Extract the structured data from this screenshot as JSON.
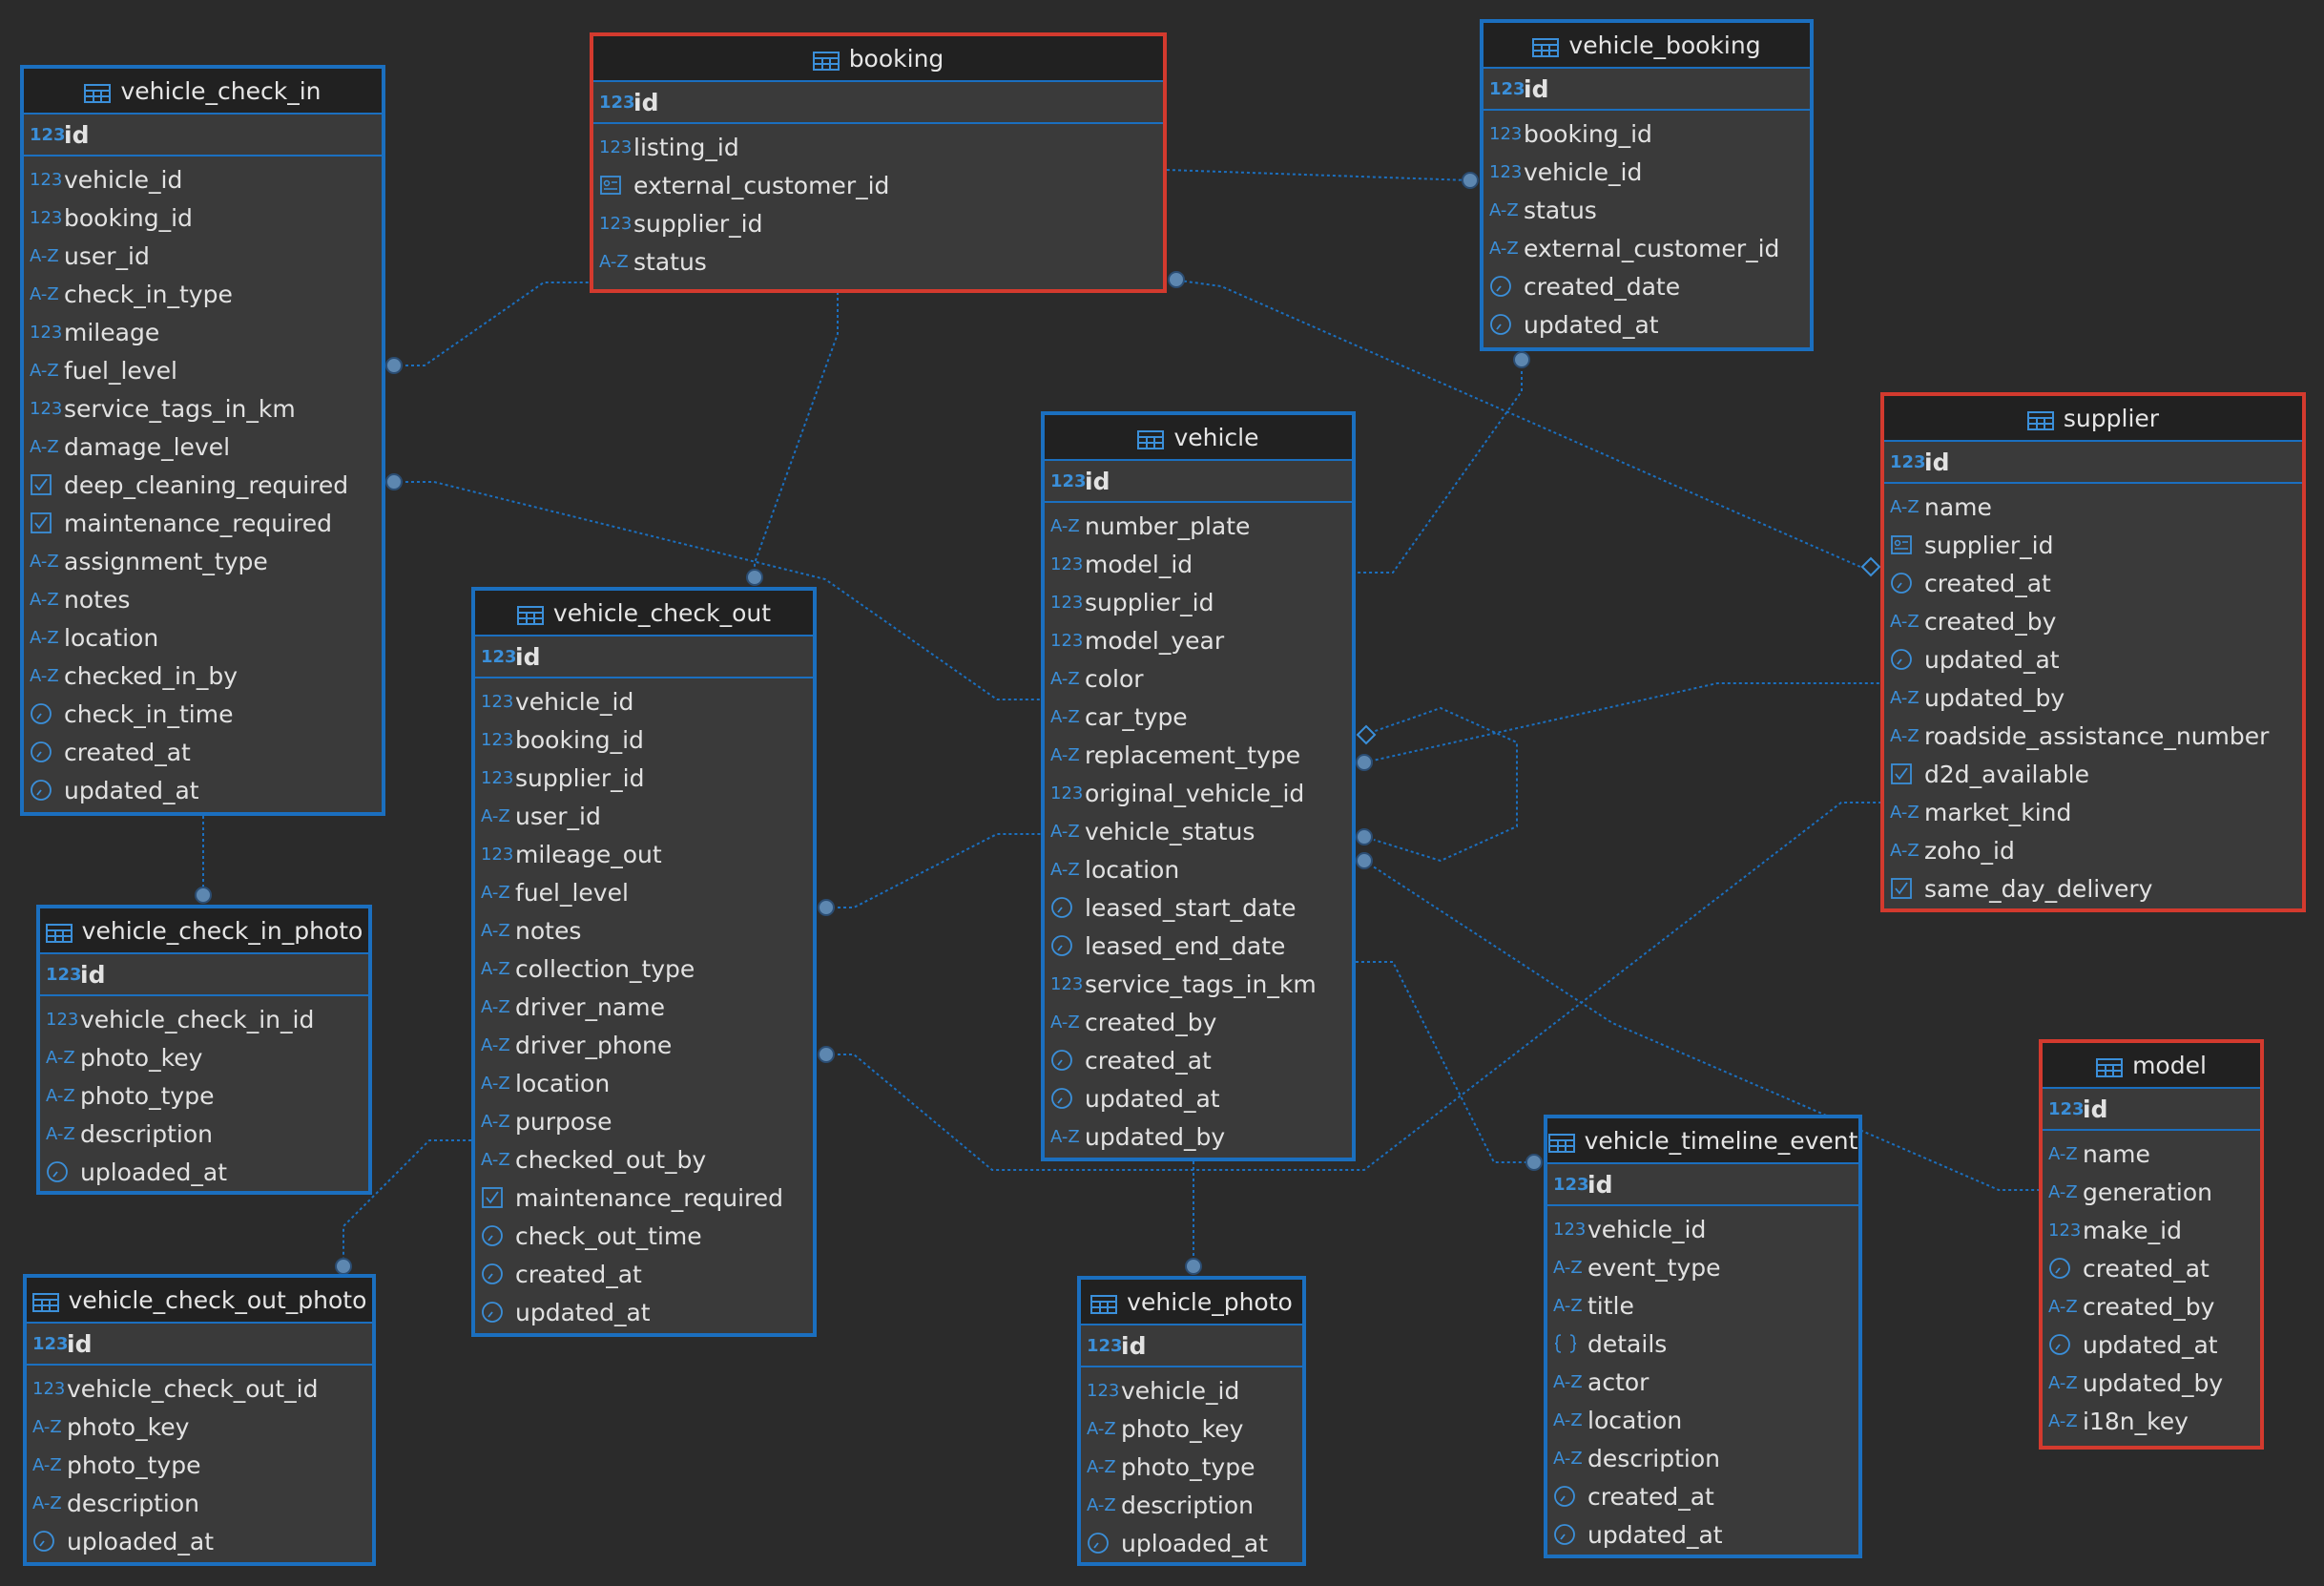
{
  "type_glyphs": {
    "num": "123",
    "str": "A-Z"
  },
  "colors": {
    "background": "#2b2b2b",
    "table": "#3a3a3a",
    "border": "#1b6fbf",
    "selected_border": "#d33a2e",
    "accent": "#3b8fd9"
  },
  "tables": [
    {
      "id": "vehicle_check_in",
      "title": "vehicle_check_in",
      "selected": false,
      "columns": [
        {
          "name": "id",
          "type": "num",
          "pk": true
        },
        {
          "name": "vehicle_id",
          "type": "num"
        },
        {
          "name": "booking_id",
          "type": "num"
        },
        {
          "name": "user_id",
          "type": "str"
        },
        {
          "name": "check_in_type",
          "type": "str"
        },
        {
          "name": "mileage",
          "type": "num"
        },
        {
          "name": "fuel_level",
          "type": "str"
        },
        {
          "name": "service_tags_in_km",
          "type": "num"
        },
        {
          "name": "damage_level",
          "type": "str"
        },
        {
          "name": "deep_cleaning_required",
          "type": "bool"
        },
        {
          "name": "maintenance_required",
          "type": "bool"
        },
        {
          "name": "assignment_type",
          "type": "str"
        },
        {
          "name": "notes",
          "type": "str"
        },
        {
          "name": "location",
          "type": "str"
        },
        {
          "name": "checked_in_by",
          "type": "str"
        },
        {
          "name": "check_in_time",
          "type": "time"
        },
        {
          "name": "created_at",
          "type": "time"
        },
        {
          "name": "updated_at",
          "type": "time"
        }
      ]
    },
    {
      "id": "booking",
      "title": "booking",
      "selected": true,
      "columns": [
        {
          "name": "id",
          "type": "num",
          "pk": true
        },
        {
          "name": "listing_id",
          "type": "num"
        },
        {
          "name": "external_customer_id",
          "type": "card"
        },
        {
          "name": "supplier_id",
          "type": "num"
        },
        {
          "name": "status",
          "type": "str"
        }
      ]
    },
    {
      "id": "vehicle_booking",
      "title": "vehicle_booking",
      "selected": false,
      "columns": [
        {
          "name": "id",
          "type": "num",
          "pk": true
        },
        {
          "name": "booking_id",
          "type": "num"
        },
        {
          "name": "vehicle_id",
          "type": "num"
        },
        {
          "name": "status",
          "type": "str"
        },
        {
          "name": "external_customer_id",
          "type": "str"
        },
        {
          "name": "created_date",
          "type": "time"
        },
        {
          "name": "updated_at",
          "type": "time"
        }
      ]
    },
    {
      "id": "vehicle",
      "title": "vehicle",
      "selected": false,
      "columns": [
        {
          "name": "id",
          "type": "num",
          "pk": true
        },
        {
          "name": "number_plate",
          "type": "str"
        },
        {
          "name": "model_id",
          "type": "num"
        },
        {
          "name": "supplier_id",
          "type": "num"
        },
        {
          "name": "model_year",
          "type": "num"
        },
        {
          "name": "color",
          "type": "str"
        },
        {
          "name": "car_type",
          "type": "str"
        },
        {
          "name": "replacement_type",
          "type": "str"
        },
        {
          "name": "original_vehicle_id",
          "type": "num"
        },
        {
          "name": "vehicle_status",
          "type": "str"
        },
        {
          "name": "location",
          "type": "str"
        },
        {
          "name": "leased_start_date",
          "type": "time"
        },
        {
          "name": "leased_end_date",
          "type": "time"
        },
        {
          "name": "service_tags_in_km",
          "type": "num"
        },
        {
          "name": "created_by",
          "type": "str"
        },
        {
          "name": "created_at",
          "type": "time"
        },
        {
          "name": "updated_at",
          "type": "time"
        },
        {
          "name": "updated_by",
          "type": "str"
        }
      ]
    },
    {
      "id": "supplier",
      "title": "supplier",
      "selected": true,
      "columns": [
        {
          "name": "id",
          "type": "num",
          "pk": true
        },
        {
          "name": "name",
          "type": "str"
        },
        {
          "name": "supplier_id",
          "type": "card"
        },
        {
          "name": "created_at",
          "type": "time"
        },
        {
          "name": "created_by",
          "type": "str"
        },
        {
          "name": "updated_at",
          "type": "time"
        },
        {
          "name": "updated_by",
          "type": "str"
        },
        {
          "name": "roadside_assistance_number",
          "type": "str"
        },
        {
          "name": "d2d_available",
          "type": "bool"
        },
        {
          "name": "market_kind",
          "type": "str"
        },
        {
          "name": "zoho_id",
          "type": "str"
        },
        {
          "name": "same_day_delivery",
          "type": "bool"
        }
      ]
    },
    {
      "id": "vehicle_check_out",
      "title": "vehicle_check_out",
      "selected": false,
      "columns": [
        {
          "name": "id",
          "type": "num",
          "pk": true
        },
        {
          "name": "vehicle_id",
          "type": "num"
        },
        {
          "name": "booking_id",
          "type": "num"
        },
        {
          "name": "supplier_id",
          "type": "num"
        },
        {
          "name": "user_id",
          "type": "str"
        },
        {
          "name": "mileage_out",
          "type": "num"
        },
        {
          "name": "fuel_level",
          "type": "str"
        },
        {
          "name": "notes",
          "type": "str"
        },
        {
          "name": "collection_type",
          "type": "str"
        },
        {
          "name": "driver_name",
          "type": "str"
        },
        {
          "name": "driver_phone",
          "type": "str"
        },
        {
          "name": "location",
          "type": "str"
        },
        {
          "name": "purpose",
          "type": "str"
        },
        {
          "name": "checked_out_by",
          "type": "str"
        },
        {
          "name": "maintenance_required",
          "type": "bool"
        },
        {
          "name": "check_out_time",
          "type": "time"
        },
        {
          "name": "created_at",
          "type": "time"
        },
        {
          "name": "updated_at",
          "type": "time"
        }
      ]
    },
    {
      "id": "vehicle_check_in_photo",
      "title": "vehicle_check_in_photo",
      "selected": false,
      "columns": [
        {
          "name": "id",
          "type": "num",
          "pk": true
        },
        {
          "name": "vehicle_check_in_id",
          "type": "num"
        },
        {
          "name": "photo_key",
          "type": "str"
        },
        {
          "name": "photo_type",
          "type": "str"
        },
        {
          "name": "description",
          "type": "str"
        },
        {
          "name": "uploaded_at",
          "type": "time"
        }
      ]
    },
    {
      "id": "vehicle_check_out_photo",
      "title": "vehicle_check_out_photo",
      "selected": false,
      "columns": [
        {
          "name": "id",
          "type": "num",
          "pk": true
        },
        {
          "name": "vehicle_check_out_id",
          "type": "num"
        },
        {
          "name": "photo_key",
          "type": "str"
        },
        {
          "name": "photo_type",
          "type": "str"
        },
        {
          "name": "description",
          "type": "str"
        },
        {
          "name": "uploaded_at",
          "type": "time"
        }
      ]
    },
    {
      "id": "vehicle_photo",
      "title": "vehicle_photo",
      "selected": false,
      "columns": [
        {
          "name": "id",
          "type": "num",
          "pk": true
        },
        {
          "name": "vehicle_id",
          "type": "num"
        },
        {
          "name": "photo_key",
          "type": "str"
        },
        {
          "name": "photo_type",
          "type": "str"
        },
        {
          "name": "description",
          "type": "str"
        },
        {
          "name": "uploaded_at",
          "type": "time"
        }
      ]
    },
    {
      "id": "vehicle_timeline_event",
      "title": "vehicle_timeline_event",
      "selected": false,
      "columns": [
        {
          "name": "id",
          "type": "num",
          "pk": true
        },
        {
          "name": "vehicle_id",
          "type": "num"
        },
        {
          "name": "event_type",
          "type": "str"
        },
        {
          "name": "title",
          "type": "str"
        },
        {
          "name": "details",
          "type": "json"
        },
        {
          "name": "actor",
          "type": "str"
        },
        {
          "name": "location",
          "type": "str"
        },
        {
          "name": "description",
          "type": "str"
        },
        {
          "name": "created_at",
          "type": "time"
        },
        {
          "name": "updated_at",
          "type": "time"
        }
      ]
    },
    {
      "id": "model",
      "title": "model",
      "selected": true,
      "columns": [
        {
          "name": "id",
          "type": "num",
          "pk": true
        },
        {
          "name": "name",
          "type": "str"
        },
        {
          "name": "generation",
          "type": "str"
        },
        {
          "name": "make_id",
          "type": "num"
        },
        {
          "name": "created_at",
          "type": "time"
        },
        {
          "name": "created_by",
          "type": "str"
        },
        {
          "name": "updated_at",
          "type": "time"
        },
        {
          "name": "updated_by",
          "type": "str"
        },
        {
          "name": "i18n_key",
          "type": "str"
        }
      ]
    }
  ]
}
